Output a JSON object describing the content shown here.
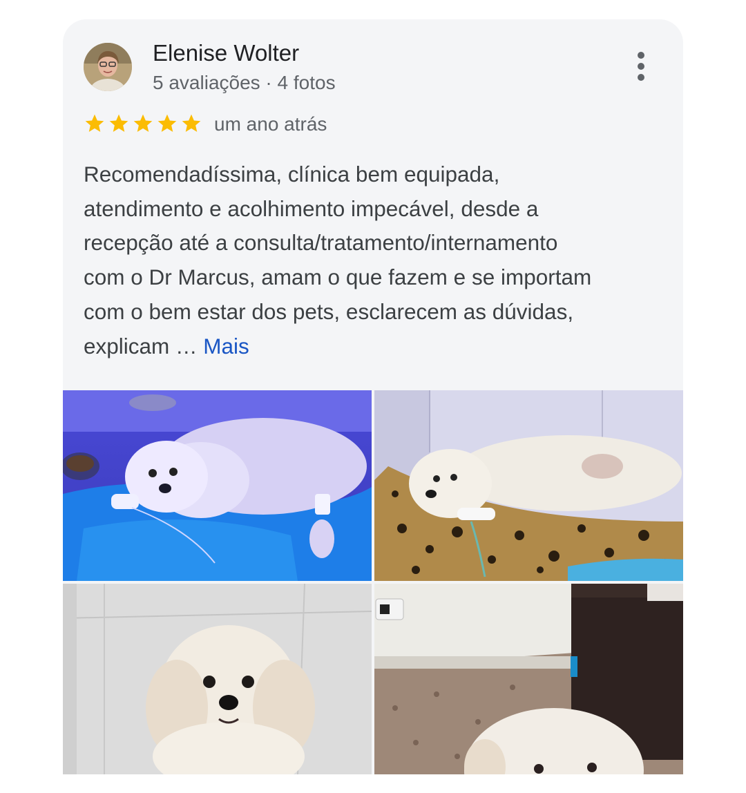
{
  "review": {
    "reviewer_name": "Elenise Wolter",
    "reviewer_meta": "5 avaliações · 4 fotos",
    "rating": 5,
    "time_ago": "um ano atrás",
    "text_lines": [
      "Recomendadíssima, clínica bem equipada,",
      "atendimento e acolhimento impecável, desde a",
      "recepção até a consulta/tratamento/internamento",
      "com o Dr Marcus, amam o que fazem e se importam",
      "com o bem estar dos pets, esclarecem as dúvidas,",
      "explicam … "
    ],
    "more_label": "Mais"
  },
  "icons": {
    "avatar": "avatar-photo",
    "menu": "more-vert-icon",
    "star": "star-icon"
  },
  "colors": {
    "star": "#fbbc04",
    "link": "#1a56c4",
    "card_bg": "#f4f5f7"
  },
  "photos": [
    {
      "name": "photo-dog-blue-light"
    },
    {
      "name": "photo-dog-leopard-blanket"
    },
    {
      "name": "photo-dog-closeup"
    },
    {
      "name": "photo-dog-on-rug"
    }
  ]
}
